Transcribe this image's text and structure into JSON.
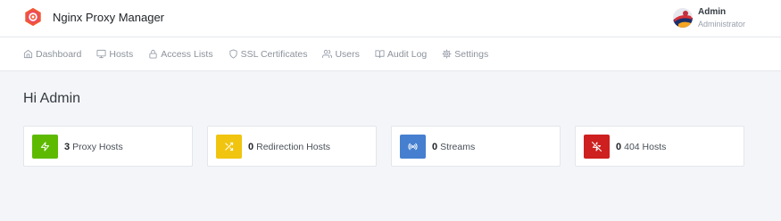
{
  "header": {
    "app_name": "Nginx Proxy Manager",
    "logo_icon": "nginx-proxy-manager-logo",
    "user": {
      "name": "Admin",
      "role": "Administrator",
      "avatar_icon": "user-avatar"
    }
  },
  "nav": {
    "items": [
      {
        "label": "Dashboard",
        "icon": "home-icon"
      },
      {
        "label": "Hosts",
        "icon": "monitor-icon"
      },
      {
        "label": "Access Lists",
        "icon": "lock-icon"
      },
      {
        "label": "SSL Certificates",
        "icon": "shield-icon"
      },
      {
        "label": "Users",
        "icon": "users-icon"
      },
      {
        "label": "Audit Log",
        "icon": "book-open-icon"
      },
      {
        "label": "Settings",
        "icon": "gear-icon"
      }
    ]
  },
  "main": {
    "greeting": "Hi Admin"
  },
  "stats": [
    {
      "count": "3",
      "label": "Proxy Hosts",
      "icon": "zap-icon",
      "color": "#5eba00"
    },
    {
      "count": "0",
      "label": "Redirection Hosts",
      "icon": "shuffle-icon",
      "color": "#f1c40f"
    },
    {
      "count": "0",
      "label": "Streams",
      "icon": "radio-icon",
      "color": "#467fcf"
    },
    {
      "count": "0",
      "label": "404 Hosts",
      "icon": "zap-off-icon",
      "color": "#cd201f"
    }
  ]
}
